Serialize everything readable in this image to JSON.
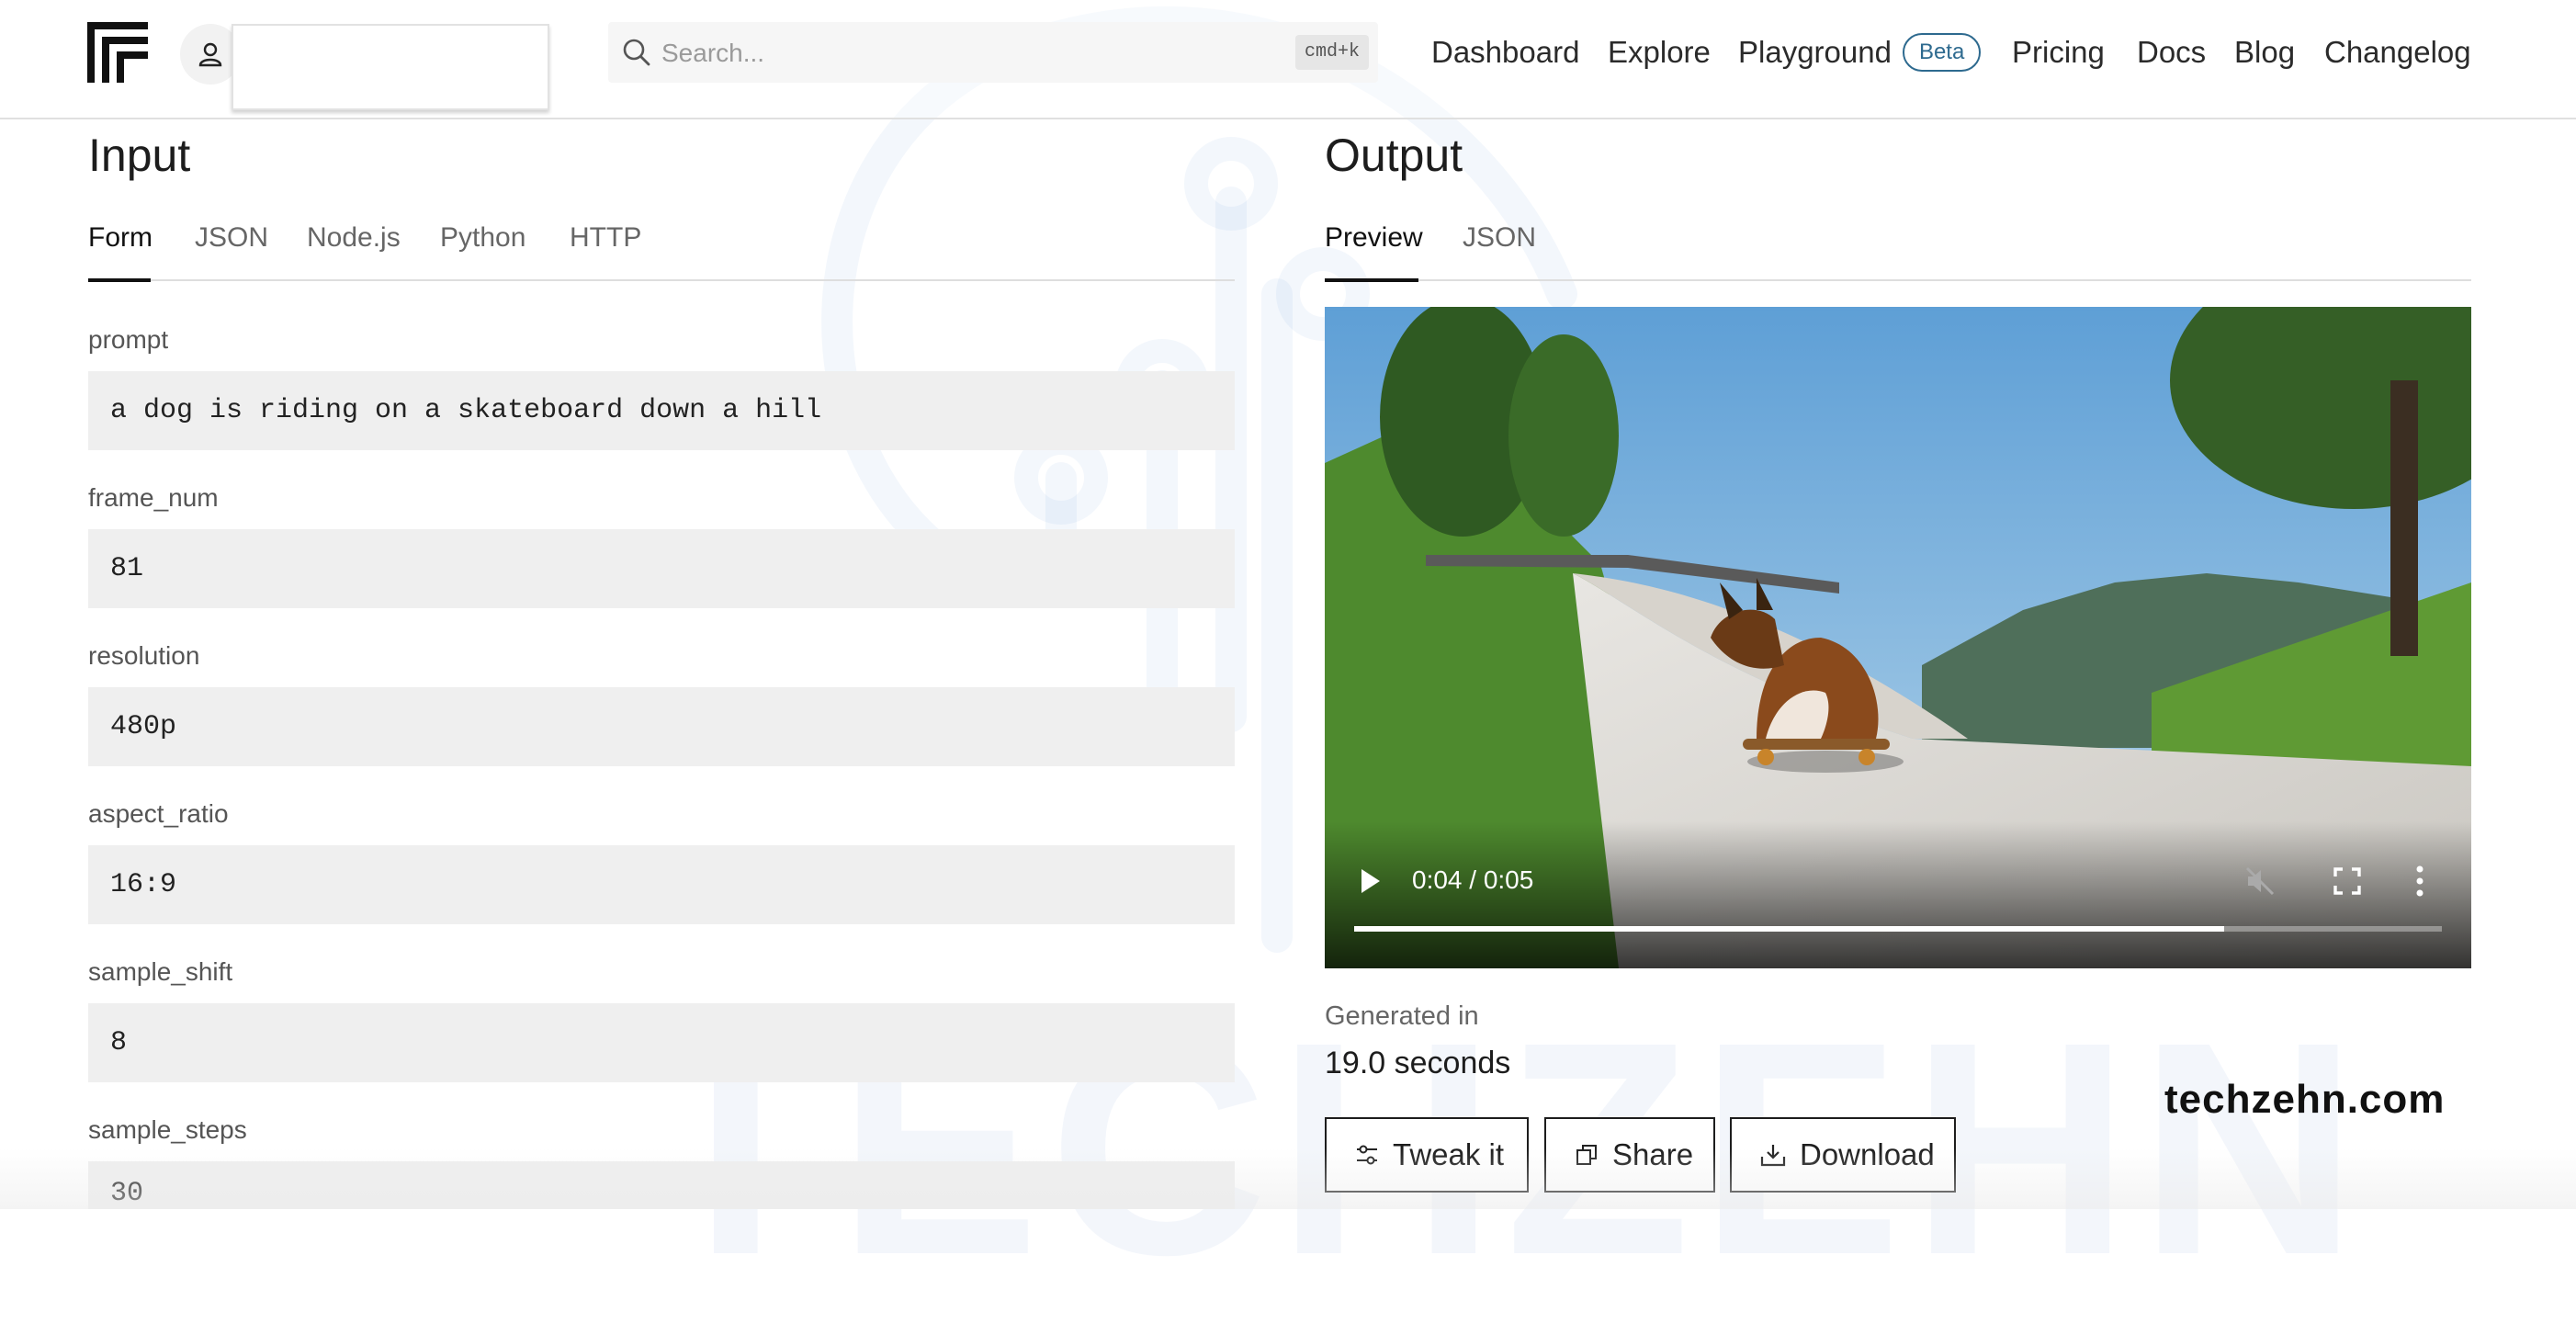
{
  "header": {
    "search_placeholder": "Search...",
    "search_shortcut": "cmd+k",
    "nav": [
      {
        "label": "Dashboard"
      },
      {
        "label": "Explore"
      },
      {
        "label": "Playground",
        "badge": "Beta"
      },
      {
        "label": "Pricing"
      },
      {
        "label": "Docs"
      },
      {
        "label": "Blog"
      },
      {
        "label": "Changelog"
      }
    ]
  },
  "input": {
    "title": "Input",
    "tabs": [
      "Form",
      "JSON",
      "Node.js",
      "Python",
      "HTTP"
    ],
    "active_tab": "Form",
    "fields": [
      {
        "label": "prompt",
        "value": "a dog is riding on a skateboard down a hill"
      },
      {
        "label": "frame_num",
        "value": "81"
      },
      {
        "label": "resolution",
        "value": "480p"
      },
      {
        "label": "aspect_ratio",
        "value": "16:9"
      },
      {
        "label": "sample_shift",
        "value": "8"
      },
      {
        "label": "sample_steps",
        "value": "30"
      }
    ]
  },
  "output": {
    "title": "Output",
    "tabs": [
      "Preview",
      "JSON"
    ],
    "active_tab": "Preview",
    "video": {
      "time_display": "0:04 / 0:05",
      "progress_fraction": 0.8,
      "muted": true
    },
    "generated_label": "Generated in",
    "generated_value": "19.0 seconds",
    "actions": {
      "tweak": "Tweak it",
      "share": "Share",
      "download": "Download"
    }
  },
  "watermark": {
    "brand_text": "TECHZEHN",
    "site": "techzehn.com"
  },
  "colors": {
    "accent_badge": "#2e6a8f",
    "watermark_blue": "#2a5fc4",
    "field_bg": "#efefef"
  }
}
